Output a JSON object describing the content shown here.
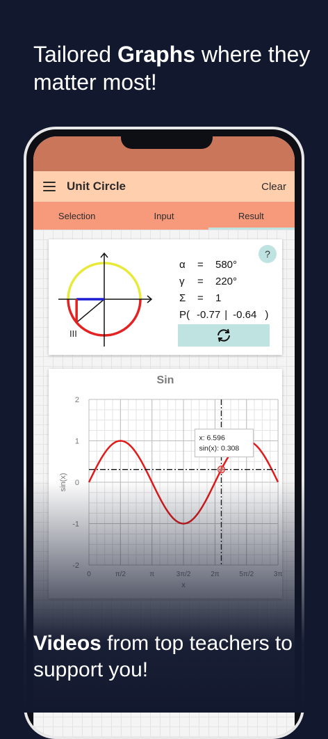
{
  "headline": {
    "pre": "Tailored ",
    "bold": "Graphs",
    "post": " where they matter most!"
  },
  "app": {
    "title": "Unit Circle",
    "clear_label": "Clear",
    "tabs": [
      {
        "label": "Selection"
      },
      {
        "label": "Input"
      },
      {
        "label": "Result"
      }
    ],
    "active_tab": "Result"
  },
  "unit_circle": {
    "help_label": "?",
    "quadrant": "III",
    "alpha_symbol": "α",
    "alpha_eq": "=",
    "alpha_value": "580°",
    "gamma_symbol": "γ",
    "gamma_eq": "=",
    "gamma_value": "220°",
    "sigma_symbol": "Σ",
    "sigma_eq": "=",
    "sigma_value": "1",
    "point_prefix": "P(",
    "point_x": "-0.77",
    "point_sep": "|",
    "point_y": "-0.64",
    "point_suffix": ")",
    "angle_deg": 220,
    "colors": {
      "upper_arc": "#e8ea3b",
      "lower_arc": "#e32222",
      "cos_line": "#1d1dd6",
      "sin_line": "#e32222"
    }
  },
  "chart_data": {
    "type": "line",
    "title": "Sin",
    "xlabel": "x",
    "ylabel": "sin(x)",
    "function": "sin",
    "x_range": [
      0,
      9.42
    ],
    "xlim": [
      0,
      9.42
    ],
    "ylim": [
      -2,
      2
    ],
    "x_ticks": [
      {
        "value": 0,
        "label": "0"
      },
      {
        "value": 1.5708,
        "label": "π/2"
      },
      {
        "value": 3.1416,
        "label": "π"
      },
      {
        "value": 4.7124,
        "label": "3π/2"
      },
      {
        "value": 6.2832,
        "label": "2π"
      },
      {
        "value": 7.854,
        "label": "5π/2"
      },
      {
        "value": 9.4248,
        "label": "3π"
      }
    ],
    "y_ticks": [
      {
        "value": 2,
        "label": "2"
      },
      {
        "value": 1,
        "label": "1"
      },
      {
        "value": 0,
        "label": "0"
      },
      {
        "value": -1,
        "label": "-1"
      },
      {
        "value": -2,
        "label": "-2"
      }
    ],
    "grid": true,
    "series_color": "#e21a1a",
    "marker": {
      "x": 6.596,
      "y": 0.308
    },
    "tooltip": {
      "line1": "x: 6.596",
      "line2": "sin(x): 0.308"
    }
  },
  "bottom": {
    "bold": "Videos",
    "post": " from top teachers to support you!"
  }
}
